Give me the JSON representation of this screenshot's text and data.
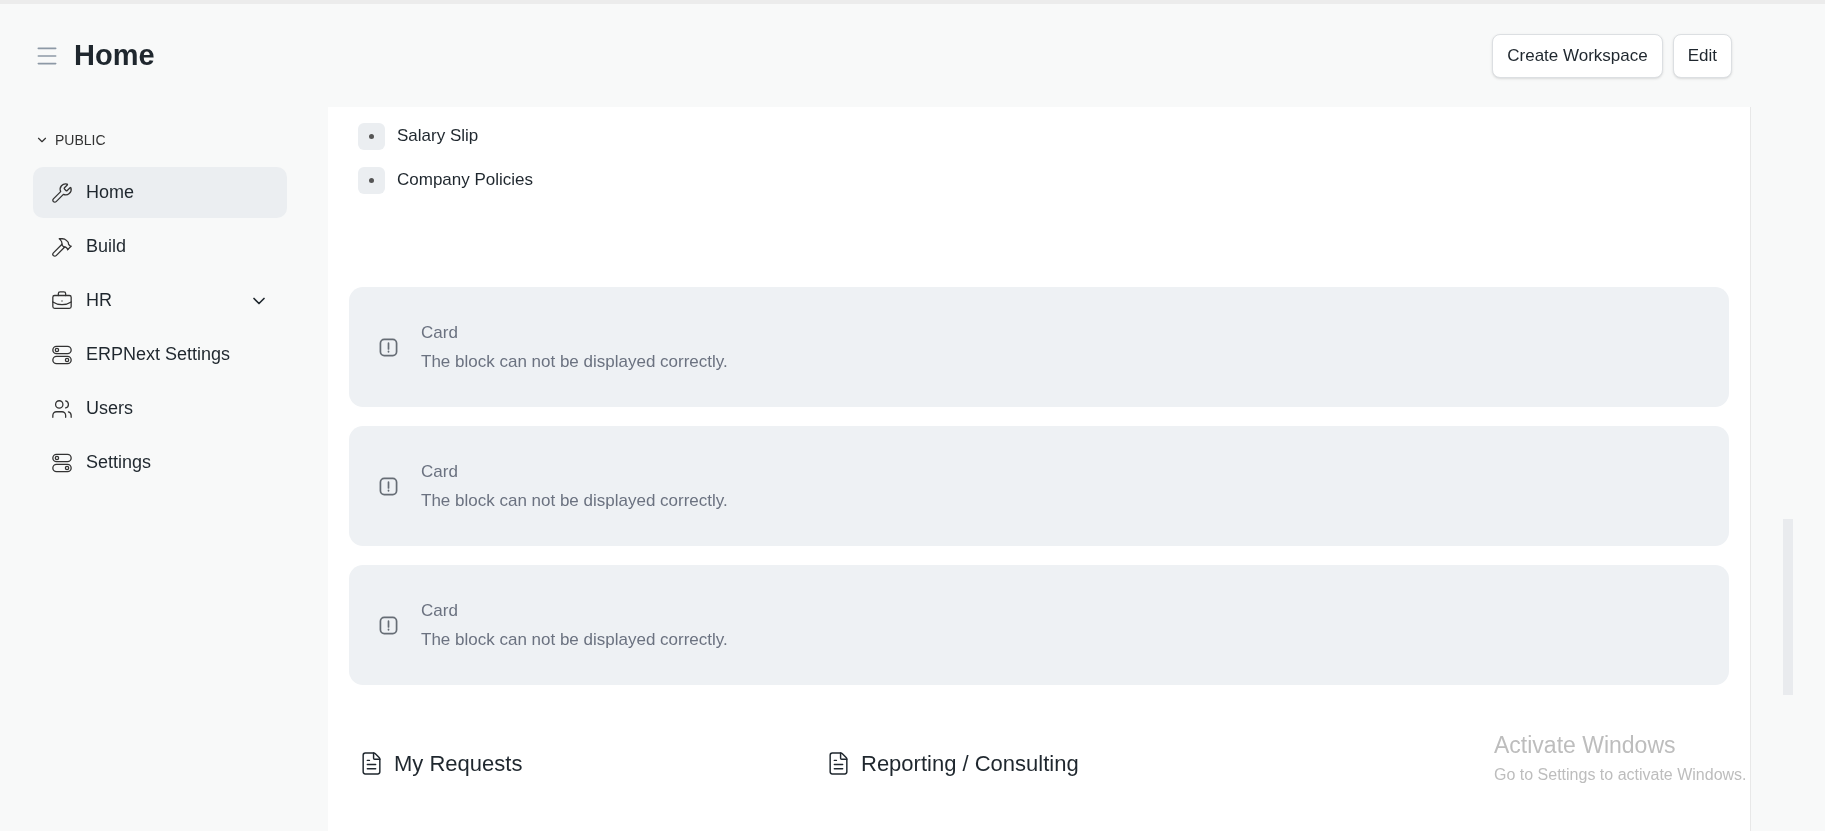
{
  "header": {
    "title": "Home",
    "buttons": [
      "Create Workspace",
      "Edit"
    ]
  },
  "sidebar": {
    "section": {
      "label": "PUBLIC",
      "expanded": true
    },
    "items": [
      {
        "label": "Home",
        "selected": true,
        "kind": "link"
      },
      {
        "label": "Build",
        "selected": false,
        "kind": "link"
      },
      {
        "label": "HR",
        "selected": false,
        "kind": "group",
        "expanded": false
      },
      {
        "label": "ERPNext Settings",
        "selected": false,
        "kind": "link"
      },
      {
        "label": "Users",
        "selected": false,
        "kind": "link"
      },
      {
        "label": "Settings",
        "selected": false,
        "kind": "link"
      }
    ]
  },
  "content": {
    "links": [
      "Salary Slip",
      "Company Policies"
    ],
    "cards": [
      {
        "title": "Card",
        "message": "The block can not be displayed correctly."
      },
      {
        "title": "Card",
        "message": "The block can not be displayed correctly."
      },
      {
        "title": "Card",
        "message": "The block can not be displayed correctly."
      }
    ],
    "sections": [
      "My Requests",
      "Reporting / Consulting"
    ]
  },
  "os_overlay": {
    "title": "Activate Windows",
    "message": "Go to Settings to activate Windows."
  }
}
